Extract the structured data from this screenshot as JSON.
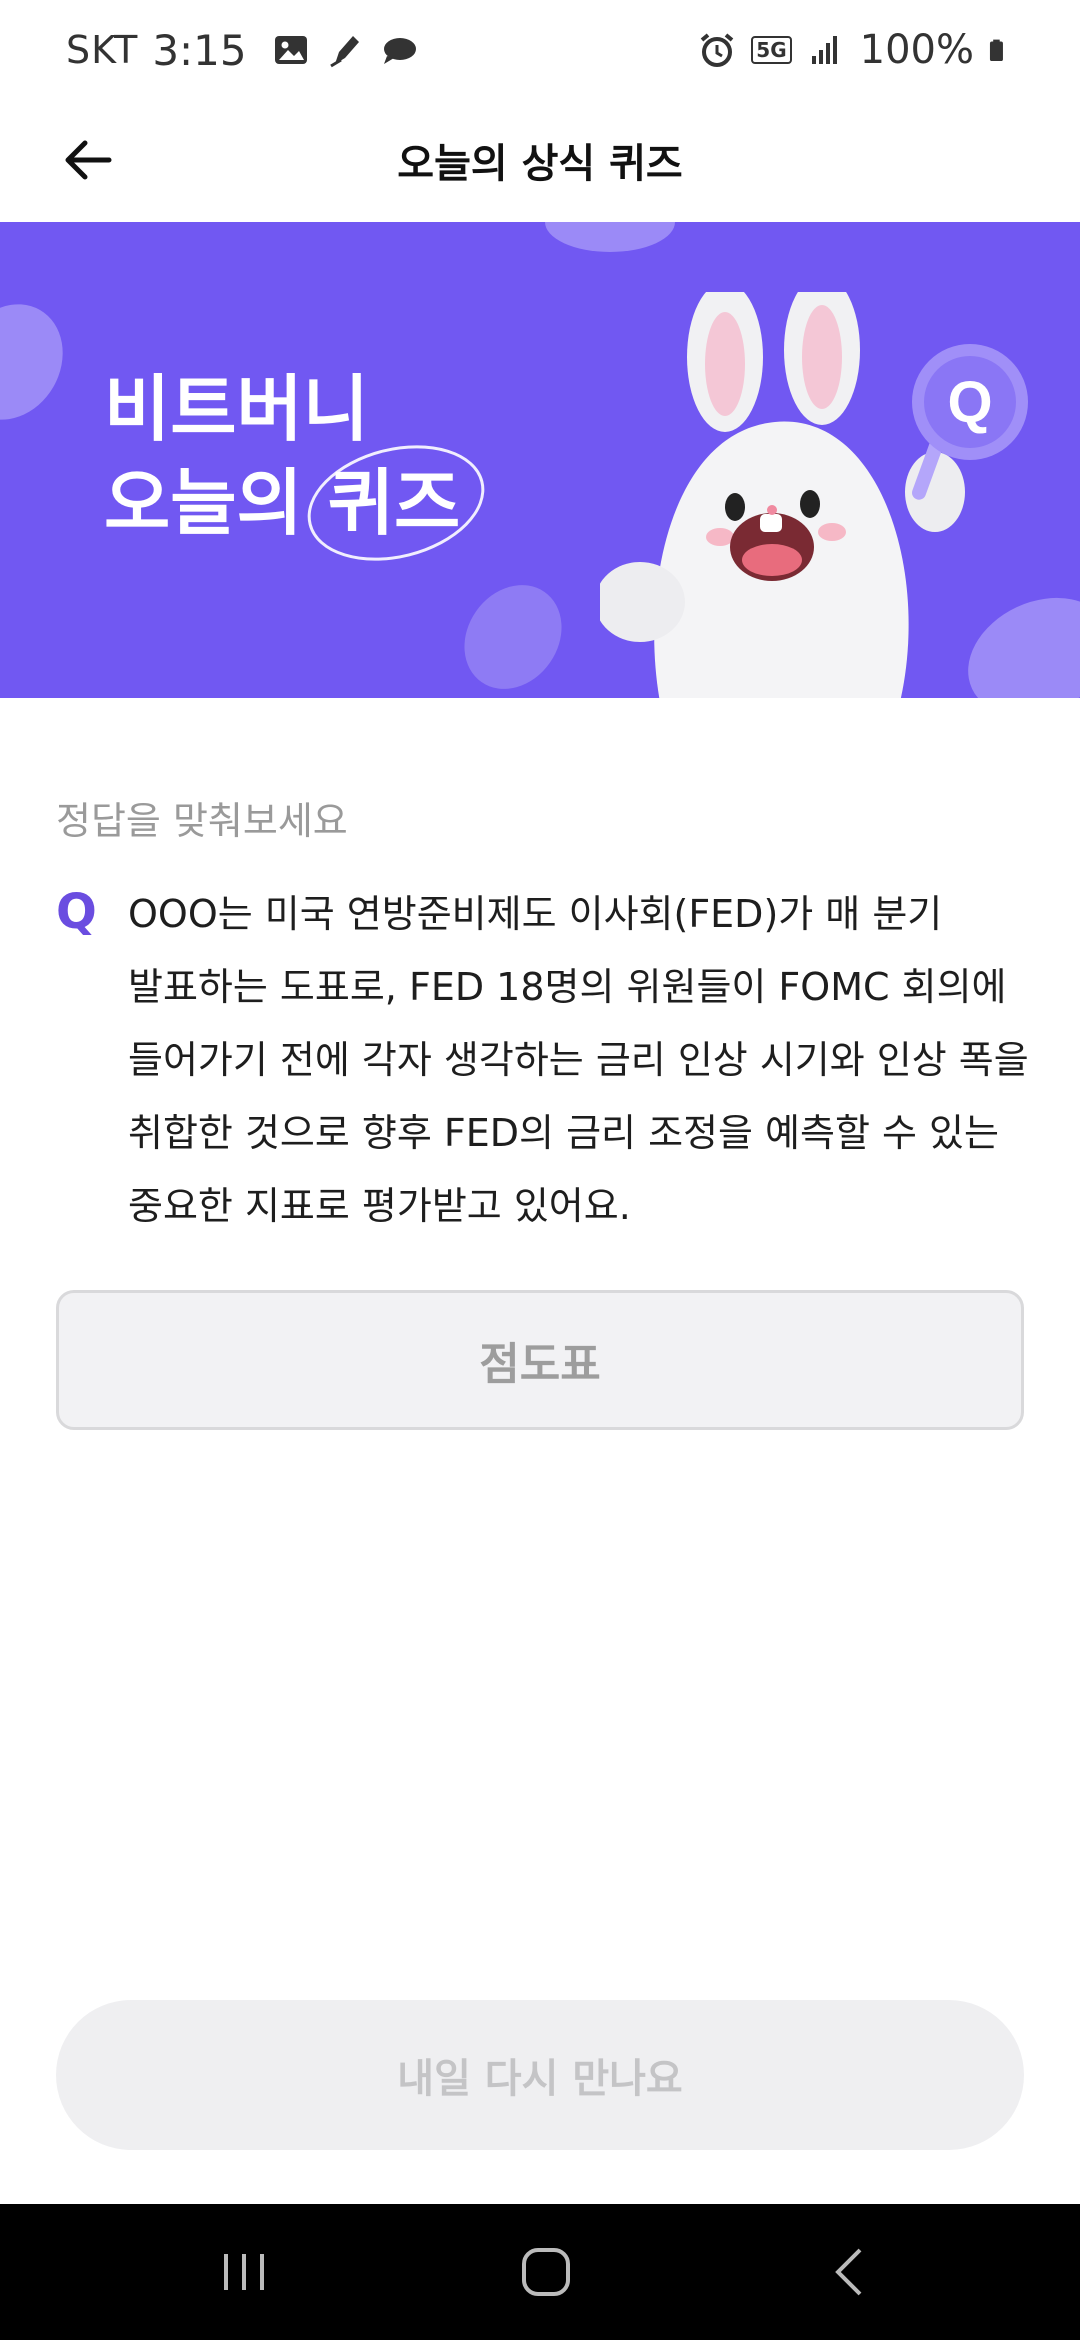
{
  "status_bar": {
    "carrier": "SKT",
    "time": "3:15",
    "network": "5G",
    "battery": "100%",
    "icons": [
      "gallery-icon",
      "pen-icon",
      "cloud-icon",
      "alarm-icon",
      "5g-icon",
      "signal-icon",
      "battery-icon"
    ]
  },
  "app_bar": {
    "title": "오늘의 상식 퀴즈",
    "back_icon": "back-arrow-icon"
  },
  "banner": {
    "line1": "비트버니",
    "line2_prefix": "오늘의 ",
    "line2_highlight": "퀴즈",
    "badge_letter": "Q",
    "background_color": "#7158f2"
  },
  "quiz": {
    "hint": "정답을 맞춰보세요",
    "q_mark": "Q",
    "question": "OOO는 미국 연방준비제도 이사회(FED)가 매 분기 발표하는 도표로, FED 18명의 위원들이 FOMC 회의에 들어가기 전에 각자 생각하는 금리 인상 시기와 인상 폭을 취합한 것으로 향후 FED의 금리 조정을 예측할 수 있는 중요한 지표로 평가받고 있어요.",
    "answer": "점도표"
  },
  "footer": {
    "button_label": "내일 다시 만나요"
  },
  "nav_bar": {
    "icons": [
      "recent-apps-icon",
      "home-icon",
      "back-icon"
    ]
  },
  "colors": {
    "accent": "#6a4de0",
    "banner": "#7158f2"
  }
}
